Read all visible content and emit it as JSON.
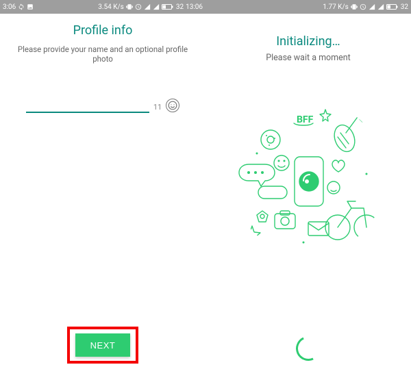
{
  "left": {
    "status": {
      "time": "3:06",
      "speed": "3.54 K/s",
      "battery": "32",
      "clock": "13:06"
    },
    "title": "Profile info",
    "subtitle": "Please provide your name and an optional profile photo",
    "input_value": "",
    "char_count": "11",
    "next_label": "NEXT"
  },
  "right": {
    "status": {
      "speed": "1.77 K/s",
      "battery": "32"
    },
    "title": "Initializing…",
    "subtitle": "Please wait a moment"
  },
  "colors": {
    "accent": "#0b8a7f",
    "button": "#2ecc71",
    "highlight": "#f40000"
  }
}
